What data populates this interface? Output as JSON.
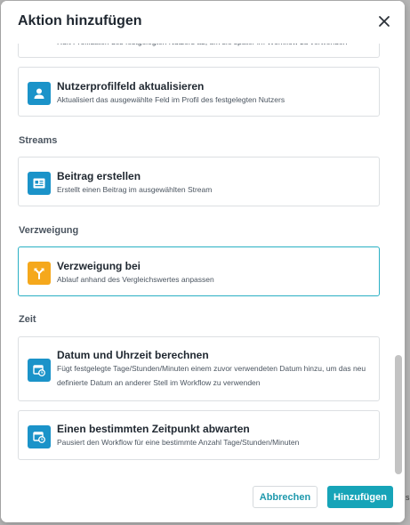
{
  "dialog": {
    "title": "Aktion hinzufügen",
    "close_icon": "close-icon"
  },
  "sections": [
    {
      "label": "",
      "cards": [
        {
          "icon": "user-icon",
          "icon_color": "#1b93c9",
          "title": "",
          "description": "Ruft Profildaten des festgelegten Nutzers ab, um sie später im Workflow zu verwenden"
        },
        {
          "icon": "user-icon",
          "icon_color": "#1b93c9",
          "title": "Nutzerprofilfeld aktualisieren",
          "description": "Aktualisiert das ausgewählte Feld im Profil des festgelegten Nutzers"
        }
      ]
    },
    {
      "label": "Streams",
      "cards": [
        {
          "icon": "post-card-icon",
          "icon_color": "#1b93c9",
          "title": "Beitrag erstellen",
          "description": "Erstellt einen Beitrag im ausgewählten Stream"
        }
      ]
    },
    {
      "label": "Verzweigung",
      "cards": [
        {
          "icon": "branch-icon",
          "icon_color": "#f5a81c",
          "title": "Verzweigung bei",
          "description": "Ablauf anhand des Vergleichswertes anpassen"
        }
      ]
    },
    {
      "label": "Zeit",
      "cards": [
        {
          "icon": "calendar-clock-icon",
          "icon_color": "#1b93c9",
          "title": "Datum und Uhrzeit berechnen",
          "description": "Fügt festgelegte Tage/Stunden/Minuten einem zuvor verwendeten Datum hinzu, um das neu definierte Datum an anderer Stell im Workflow zu verwenden"
        },
        {
          "icon": "calendar-clock-icon",
          "icon_color": "#1b93c9",
          "title": "Einen bestimmten Zeitpunkt abwarten",
          "description": "Pausiert den Workflow für eine bestimmte Anzahl Tage/Stunden/Minuten"
        }
      ]
    }
  ],
  "footer": {
    "cancel_label": "Abbrechen",
    "add_label": "Hinzufügen"
  },
  "edge_text": "s",
  "colors": {
    "accent": "#16a4b8",
    "selected_border": "#2ab0c4",
    "icon_blue": "#1b93c9",
    "icon_orange": "#f5a81c"
  }
}
